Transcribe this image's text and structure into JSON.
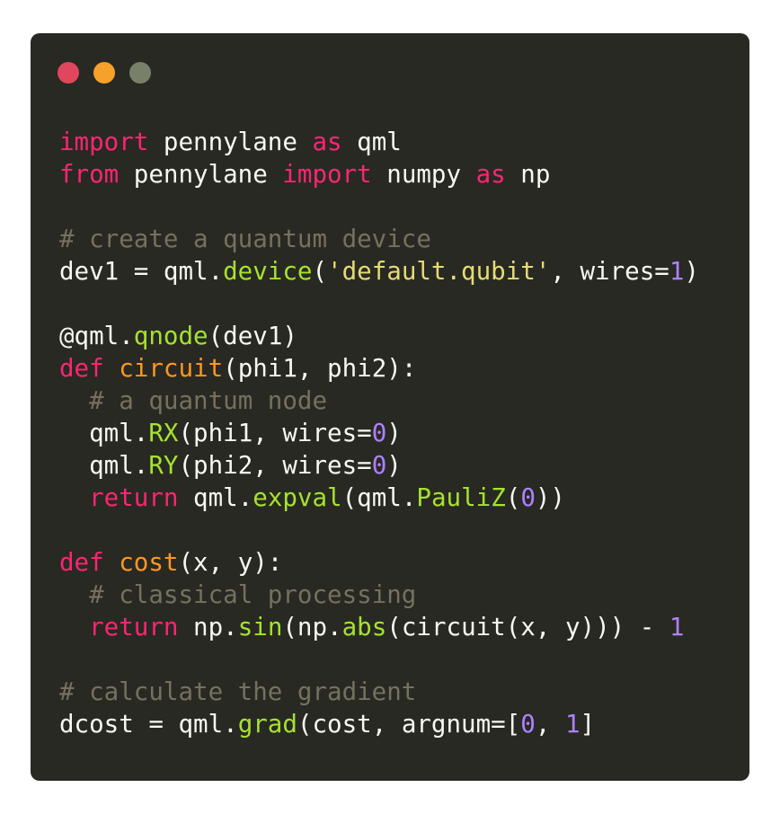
{
  "window": {
    "traffic_lights": [
      {
        "name": "close",
        "color": "#e0475d"
      },
      {
        "name": "minimize",
        "color": "#f6a12b"
      },
      {
        "name": "zoom",
        "color": "#79806a"
      }
    ]
  },
  "colors": {
    "background": "#282923",
    "default": "#f8f8f2",
    "keyword": "#f92672",
    "function": "#a6e22e",
    "string": "#e6db74",
    "number": "#ae81ff",
    "comment": "#75715e",
    "defname": "#fd971f"
  },
  "code_lines": [
    [
      [
        "kw",
        "import"
      ],
      [
        "d",
        " pennylane "
      ],
      [
        "kw",
        "as"
      ],
      [
        "d",
        " qml"
      ]
    ],
    [
      [
        "kw",
        "from"
      ],
      [
        "d",
        " pennylane "
      ],
      [
        "kw",
        "import"
      ],
      [
        "d",
        " numpy "
      ],
      [
        "kw",
        "as"
      ],
      [
        "d",
        " np"
      ]
    ],
    [],
    [
      [
        "c",
        "# create a quantum device"
      ]
    ],
    [
      [
        "d",
        "dev1 = qml."
      ],
      [
        "fn",
        "device"
      ],
      [
        "d",
        "("
      ],
      [
        "s",
        "'default.qubit'"
      ],
      [
        "d",
        ", wires="
      ],
      [
        "n",
        "1"
      ],
      [
        "d",
        ")"
      ]
    ],
    [],
    [
      [
        "d",
        "@qml."
      ],
      [
        "fn",
        "qnode"
      ],
      [
        "d",
        "(dev1)"
      ]
    ],
    [
      [
        "kw",
        "def"
      ],
      [
        "d",
        " "
      ],
      [
        "def",
        "circuit"
      ],
      [
        "d",
        "(phi1, phi2):"
      ]
    ],
    [
      [
        "d",
        "  "
      ],
      [
        "c",
        "# a quantum node"
      ]
    ],
    [
      [
        "d",
        "  qml."
      ],
      [
        "fn",
        "RX"
      ],
      [
        "d",
        "(phi1, wires="
      ],
      [
        "n",
        "0"
      ],
      [
        "d",
        ")"
      ]
    ],
    [
      [
        "d",
        "  qml."
      ],
      [
        "fn",
        "RY"
      ],
      [
        "d",
        "(phi2, wires="
      ],
      [
        "n",
        "0"
      ],
      [
        "d",
        ")"
      ]
    ],
    [
      [
        "d",
        "  "
      ],
      [
        "kw",
        "return"
      ],
      [
        "d",
        " qml."
      ],
      [
        "fn",
        "expval"
      ],
      [
        "d",
        "(qml."
      ],
      [
        "fn",
        "PauliZ"
      ],
      [
        "d",
        "("
      ],
      [
        "n",
        "0"
      ],
      [
        "d",
        "))"
      ]
    ],
    [],
    [
      [
        "kw",
        "def"
      ],
      [
        "d",
        " "
      ],
      [
        "def",
        "cost"
      ],
      [
        "d",
        "(x, y):"
      ]
    ],
    [
      [
        "d",
        "  "
      ],
      [
        "c",
        "# classical processing"
      ]
    ],
    [
      [
        "d",
        "  "
      ],
      [
        "kw",
        "return"
      ],
      [
        "d",
        " np."
      ],
      [
        "fn",
        "sin"
      ],
      [
        "d",
        "(np."
      ],
      [
        "fn",
        "abs"
      ],
      [
        "d",
        "(circuit(x, y))) - "
      ],
      [
        "n",
        "1"
      ]
    ],
    [],
    [
      [
        "c",
        "# calculate the gradient"
      ]
    ],
    [
      [
        "d",
        "dcost = qml."
      ],
      [
        "fn",
        "grad"
      ],
      [
        "d",
        "(cost, argnum=["
      ],
      [
        "n",
        "0"
      ],
      [
        "d",
        ", "
      ],
      [
        "n",
        "1"
      ],
      [
        "d",
        "]"
      ]
    ]
  ]
}
